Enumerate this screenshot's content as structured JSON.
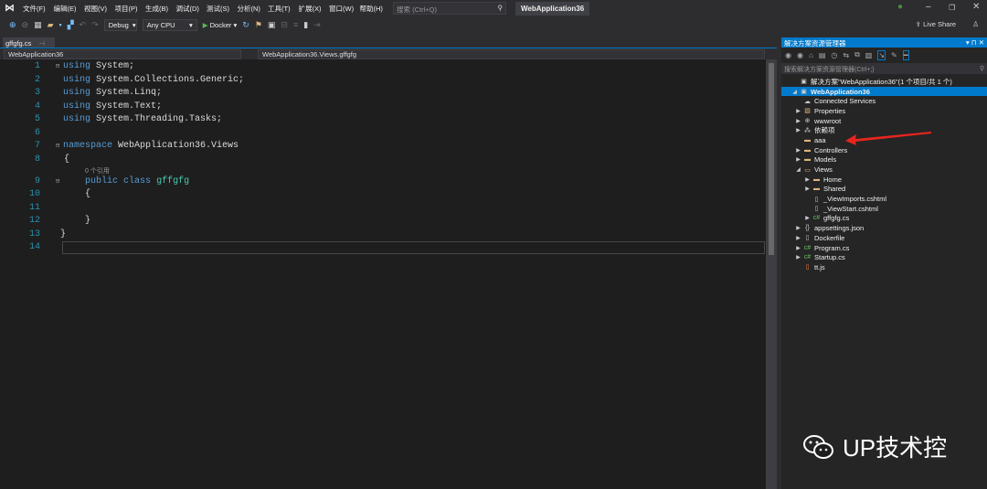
{
  "menubar": {
    "items": [
      "文件(F)",
      "编辑(E)",
      "视图(V)",
      "项目(P)",
      "生成(B)",
      "调试(D)",
      "测试(S)",
      "分析(N)",
      "工具(T)",
      "扩展(X)",
      "窗口(W)",
      "帮助(H)"
    ],
    "search_placeholder": "搜索 (Ctrl+Q)",
    "title": "WebApplication36"
  },
  "toolbar": {
    "config": "Debug",
    "platform": "Any CPU",
    "run": "Docker",
    "live_share": "Live Share"
  },
  "editor": {
    "tab": "gffgfg.cs",
    "nav_project": "WebApplication36",
    "nav_class": "WebApplication36.Views.gffgfg",
    "line_numbers": [
      "1",
      "2",
      "3",
      "4",
      "5",
      "6",
      "7",
      "8",
      "9",
      "10",
      "11",
      "12",
      "13",
      "14"
    ],
    "codelens": "0 个引用",
    "code": {
      "l1": "System;",
      "l2": "System.Collections.Generic;",
      "l3": "System.Linq;",
      "l4": "System.Text;",
      "l5": "System.Threading.Tasks;",
      "using": "using",
      "namespace": "namespace",
      "ns_name": "WebApplication36.Views",
      "public": "public",
      "class": "class",
      "class_name": "gffgfg",
      "open": "{",
      "close": "}"
    }
  },
  "solution_explorer": {
    "title": "解决方案资源管理器",
    "search_placeholder": "搜索解决方案资源管理器(Ctrl+;)",
    "solution": "解决方案\"WebApplication36\"(1 个项目/共 1 个)",
    "project": "WebApplication36",
    "items": [
      "Connected Services",
      "Properties",
      "wwwroot",
      "依赖项",
      "aaa",
      "Controllers",
      "Models",
      "Views",
      "Home",
      "Shared",
      "_ViewImports.cshtml",
      "_ViewStart.cshtml",
      "gffgfg.cs",
      "appsettings.json",
      "Dockerfile",
      "Program.cs",
      "Startup.cs",
      "tt.js"
    ]
  },
  "watermark": "UP技术控",
  "colors": {
    "accent": "#007acc",
    "editor_bg": "#1e1e1e",
    "arrow": "#e8251d"
  }
}
